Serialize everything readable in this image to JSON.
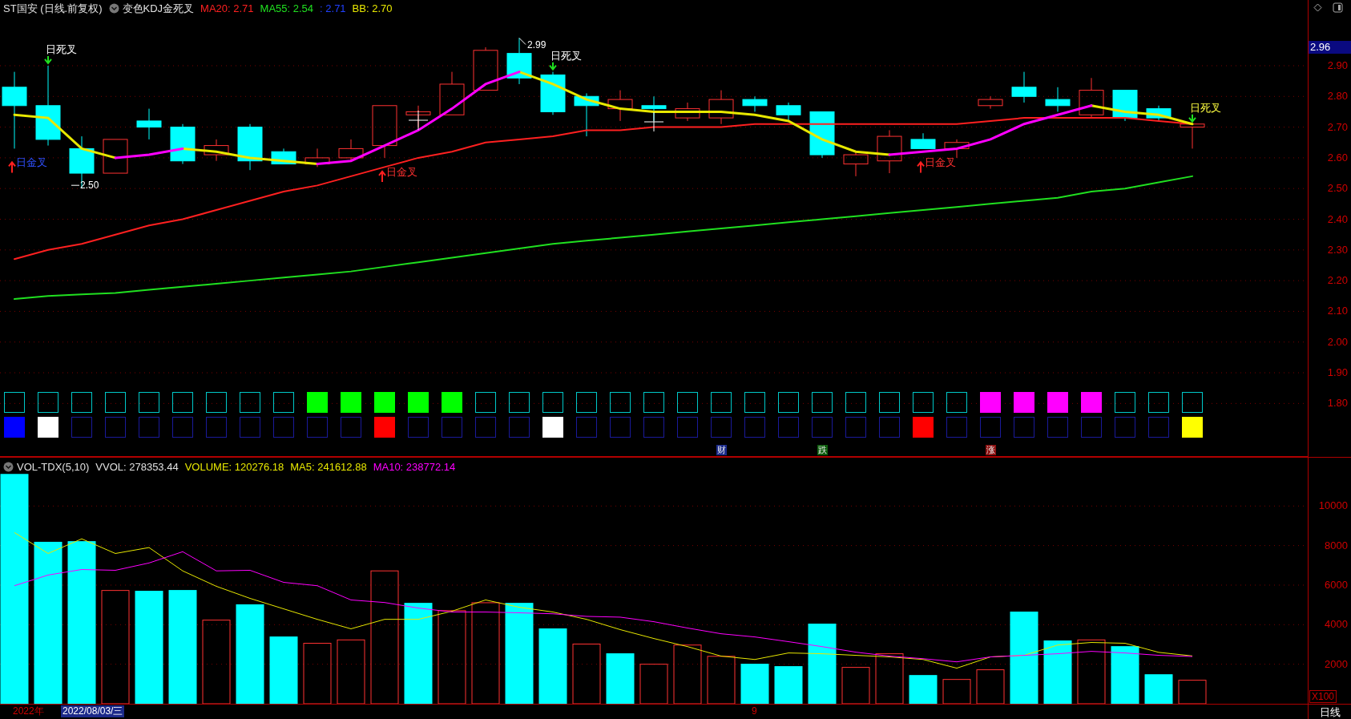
{
  "header": [
    {
      "kind": "title",
      "text": "ST国安 (日线.前复权)",
      "color": "#e0e0e0"
    },
    {
      "kind": "indicator",
      "text": "变色KDJ金死叉",
      "color": "#e0e0e0"
    },
    {
      "kind": "value",
      "text": "MA20: 2.71",
      "color": "#ff2020"
    },
    {
      "kind": "value",
      "text": "MA55: 2.54",
      "color": "#20e020"
    },
    {
      "kind": "value",
      "text": ": 2.71",
      "color": "#2040ff"
    },
    {
      "kind": "value",
      "text": "BB: 2.70",
      "color": "#e8e800"
    }
  ],
  "price_chart": {
    "chart_data": {
      "type": "line",
      "grid": true,
      "ylim": [
        1.626,
        3.114
      ],
      "yticks": [
        {
          "value": 2.9,
          "label": "2.90"
        },
        {
          "value": 2.8,
          "label": "2.80"
        },
        {
          "value": 2.7,
          "label": "2.70"
        },
        {
          "value": 2.6,
          "label": "2.60"
        },
        {
          "value": 2.5,
          "label": "2.50"
        },
        {
          "value": 2.4,
          "label": "2.40"
        },
        {
          "value": 2.3,
          "label": "2.30"
        },
        {
          "value": 2.2,
          "label": "2.20"
        },
        {
          "value": 2.1,
          "label": "2.10"
        },
        {
          "value": 2.0,
          "label": "2.00"
        },
        {
          "value": 1.9,
          "label": "1.90"
        },
        {
          "value": 1.8,
          "label": "1.80"
        }
      ],
      "series": [
        {
          "color": "#ff2020",
          "values": [
            2.27,
            2.3,
            2.32,
            2.35,
            2.38,
            2.4,
            2.43,
            2.46,
            2.49,
            2.51,
            2.54,
            2.57,
            2.6,
            2.62,
            2.65,
            2.66,
            2.67,
            2.69,
            2.69,
            2.7,
            2.7,
            2.7,
            2.71,
            2.71,
            2.71,
            2.71,
            2.71,
            2.71,
            2.71,
            2.72,
            2.73,
            2.73,
            2.73,
            2.73,
            2.72,
            2.71
          ]
        },
        {
          "color": "#20e020",
          "values": [
            2.14,
            2.15,
            2.155,
            2.16,
            2.17,
            2.18,
            2.19,
            2.2,
            2.21,
            2.22,
            2.23,
            2.245,
            2.26,
            2.275,
            2.29,
            2.305,
            2.32,
            2.33,
            2.34,
            2.35,
            2.36,
            2.37,
            2.38,
            2.39,
            2.4,
            2.41,
            2.42,
            2.43,
            2.44,
            2.45,
            2.46,
            2.47,
            2.49,
            2.5,
            2.52,
            2.54
          ]
        },
        {
          "color": "#e8e800",
          "values": [
            2.74,
            2.73,
            2.63,
            2.6,
            null,
            2.63,
            2.62,
            2.6,
            2.59,
            2.58,
            null,
            null,
            null,
            null,
            null,
            2.88,
            2.84,
            2.79,
            2.76,
            2.75,
            2.75,
            2.75,
            2.74,
            2.72,
            2.66,
            2.62,
            2.61,
            null,
            null,
            null,
            null,
            null,
            2.77,
            2.75,
            2.74,
            2.71
          ]
        },
        {
          "color": "#ff00ff",
          "values": [
            null,
            null,
            null,
            2.6,
            2.61,
            2.63,
            null,
            null,
            null,
            2.58,
            2.59,
            2.64,
            2.69,
            2.76,
            2.84,
            2.88,
            null,
            null,
            null,
            null,
            null,
            null,
            null,
            null,
            null,
            null,
            2.61,
            2.62,
            2.63,
            2.66,
            2.71,
            2.74,
            2.77,
            null,
            null,
            null
          ]
        }
      ]
    },
    "markers": [
      {
        "kind": "dead",
        "text": "日死叉",
        "color": "#ffffff"
      },
      {
        "kind": "dead",
        "text": "日死叉",
        "color": "#ffffff"
      },
      {
        "kind": "dead",
        "text": "日死叉",
        "color": "#ffff40"
      },
      {
        "kind": "golden",
        "text": "日金叉",
        "color": "#3050ff"
      },
      {
        "kind": "golden",
        "text": "日金叉",
        "color": "#ff3030"
      },
      {
        "kind": "golden",
        "text": "日金叉",
        "color": "#ff3030"
      },
      {
        "kind": "low",
        "text": "2.50"
      },
      {
        "kind": "high",
        "text": "2.99"
      }
    ],
    "current_price": "2.96"
  },
  "signals": [
    {
      "kind": "trend",
      "items": [
        {
          "filled": false
        },
        {
          "filled": false
        },
        {
          "filled": false
        },
        {
          "filled": false
        },
        {
          "filled": false
        },
        {
          "filled": false
        },
        {
          "filled": false
        },
        {
          "filled": false
        },
        {
          "filled": false
        },
        {
          "filled": true,
          "color": "#00ff00"
        },
        {
          "filled": true,
          "color": "#00ff00"
        },
        {
          "filled": true,
          "color": "#00ff00"
        },
        {
          "filled": true,
          "color": "#00ff00"
        },
        {
          "filled": true,
          "color": "#00ff00"
        },
        {
          "filled": false
        },
        {
          "filled": false
        },
        {
          "filled": false
        },
        {
          "filled": false
        },
        {
          "filled": false
        },
        {
          "filled": false
        },
        {
          "filled": false
        },
        {
          "filled": false
        },
        {
          "filled": false
        },
        {
          "filled": false
        },
        {
          "filled": false
        },
        {
          "filled": false
        },
        {
          "filled": false
        },
        {
          "filled": false
        },
        {
          "filled": false
        },
        {
          "filled": true,
          "color": "#ff00ff"
        },
        {
          "filled": true,
          "color": "#ff00ff"
        },
        {
          "filled": true,
          "color": "#ff00ff"
        },
        {
          "filled": true,
          "color": "#ff00ff"
        },
        {
          "filled": false
        },
        {
          "filled": false
        },
        {
          "filled": false
        }
      ]
    },
    {
      "kind": "event",
      "items": [
        {
          "filled": true,
          "color": "#0000ff"
        },
        {
          "filled": true,
          "color": "#ffffff"
        },
        {
          "filled": false
        },
        {
          "filled": false
        },
        {
          "filled": false
        },
        {
          "filled": false
        },
        {
          "filled": false
        },
        {
          "filled": false
        },
        {
          "filled": false
        },
        {
          "filled": false
        },
        {
          "filled": false
        },
        {
          "filled": true,
          "color": "#ff0000"
        },
        {
          "filled": false
        },
        {
          "filled": false
        },
        {
          "filled": false
        },
        {
          "filled": false
        },
        {
          "filled": true,
          "color": "#ffffff"
        },
        {
          "filled": false
        },
        {
          "filled": false
        },
        {
          "filled": false
        },
        {
          "filled": false
        },
        {
          "filled": false,
          "note": {
            "text": "财",
            "color": "#1c2c8c"
          }
        },
        {
          "filled": false
        },
        {
          "filled": false
        },
        {
          "filled": false,
          "note": {
            "text": "跌",
            "color": "#0c5c0c"
          }
        },
        {
          "filled": false
        },
        {
          "filled": false
        },
        {
          "filled": true,
          "color": "#ff0000"
        },
        {
          "filled": false
        },
        {
          "filled": false,
          "note": {
            "text": "涨",
            "color": "#8c1010"
          }
        },
        {
          "filled": false
        },
        {
          "filled": false
        },
        {
          "filled": false
        },
        {
          "filled": false
        },
        {
          "filled": false
        },
        {
          "filled": true,
          "color": "#ffff00"
        }
      ]
    }
  ],
  "volume_header": [
    {
      "kind": "indicator",
      "text": "VOL-TDX(5,10)",
      "color": "#e0e0e0"
    },
    {
      "kind": "value",
      "text": "VVOL: 278353.44",
      "color": "#e0e0e0"
    },
    {
      "kind": "value",
      "text": "VOLUME: 120276.18",
      "color": "#e8e800"
    },
    {
      "kind": "value",
      "text": "MA5: 241612.88",
      "color": "#e8e800"
    },
    {
      "kind": "value",
      "text": "MA10: 238772.14",
      "color": "#ff00ff"
    }
  ],
  "volume_chart": {
    "chart_data": {
      "type": "bar",
      "grid": true,
      "ylim": [
        0,
        12444
      ],
      "yticks": [
        {
          "value": 10000,
          "label": "10000"
        },
        {
          "value": 8000,
          "label": "8000"
        },
        {
          "value": 6000,
          "label": "6000"
        },
        {
          "value": 4000,
          "label": "4000"
        },
        {
          "value": 2000,
          "label": "2000"
        }
      ],
      "series": [
        {
          "color": "#ff3232",
          "values": [
            null,
            null,
            null,
            5730,
            null,
            null,
            4230,
            null,
            null,
            3060,
            3230,
            6720,
            null,
            4710,
            5110,
            null,
            null,
            3020,
            null,
            2000,
            2970,
            2400,
            null,
            null,
            null,
            1840,
            2530,
            null,
            1230,
            1720,
            null,
            null,
            3230,
            null,
            null,
            1190
          ]
        },
        {
          "color": "#00ffff",
          "values": [
            11600,
            8170,
            8200,
            null,
            5690,
            5730,
            null,
            5010,
            3380,
            null,
            null,
            null,
            5080,
            null,
            null,
            5080,
            3790,
            null,
            2530,
            null,
            null,
            null,
            2000,
            1880,
            4030,
            null,
            null,
            1430,
            null,
            null,
            4640,
            3180,
            null,
            2890,
            1470,
            null
          ]
        },
        {
          "type": "line",
          "color": "#e8e800",
          "values": [
            8660,
            7600,
            8340,
            7600,
            7900,
            6720,
            5940,
            5330,
            4800,
            4270,
            3790,
            4270,
            4270,
            4680,
            5250,
            4880,
            4640,
            4270,
            3750,
            3300,
            2890,
            2410,
            2240,
            2570,
            2530,
            2450,
            2370,
            2240,
            1800,
            2370,
            2450,
            2970,
            3100,
            3060,
            2600,
            2420
          ]
        },
        {
          "type": "line",
          "color": "#ff00ff",
          "values": [
            5970,
            6510,
            6790,
            6750,
            7120,
            7690,
            6720,
            6750,
            6140,
            5970,
            5250,
            5120,
            4840,
            4640,
            4640,
            4600,
            4550,
            4420,
            4380,
            4150,
            3830,
            3540,
            3380,
            3140,
            2890,
            2610,
            2410,
            2280,
            2120,
            2370,
            2450,
            2530,
            2650,
            2570,
            2450,
            2390
          ]
        }
      ]
    },
    "unit": "X100"
  },
  "time_axis": [
    {
      "kind": "year",
      "text": "2022年"
    },
    {
      "kind": "cursor",
      "text": "2022/08/03/三"
    },
    {
      "kind": "month",
      "text": "9"
    }
  ],
  "period": "日线"
}
